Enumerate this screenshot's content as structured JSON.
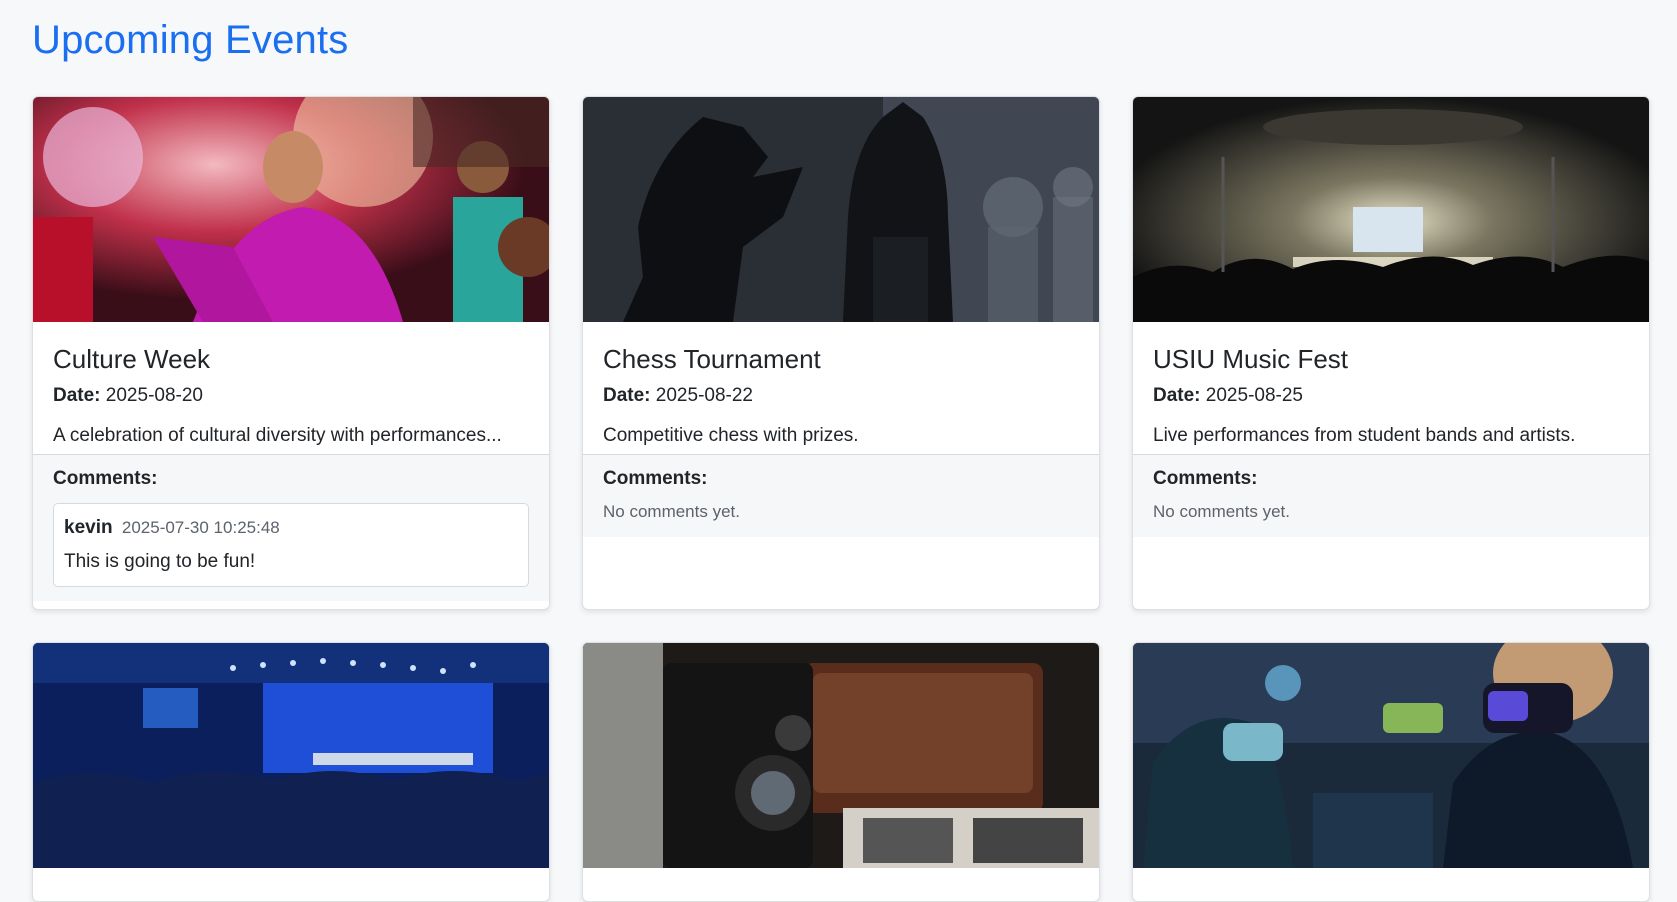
{
  "page": {
    "title": "Upcoming Events"
  },
  "labels": {
    "date": "Date:",
    "comments": "Comments:",
    "no_comments": "No comments yet."
  },
  "events": [
    {
      "image": "holi-festival-dancer",
      "title": "Culture Week",
      "date": "2025-08-20",
      "description": "A celebration of cultural diversity with performances...",
      "comments": [
        {
          "user": "kevin",
          "time": "2025-07-30 10:25:48",
          "text": "This is going to be fun!"
        }
      ]
    },
    {
      "image": "chess-pieces",
      "title": "Chess Tournament",
      "date": "2025-08-22",
      "description": "Competitive chess with prizes.",
      "comments": []
    },
    {
      "image": "concert-stage",
      "title": "USIU Music Fest",
      "date": "2025-08-25",
      "description": "Live performances from student bands and artists.",
      "comments": []
    },
    {
      "image": "conference-hall-audience"
    },
    {
      "image": "vintage-camera"
    },
    {
      "image": "vr-headset-gamers"
    }
  ]
}
